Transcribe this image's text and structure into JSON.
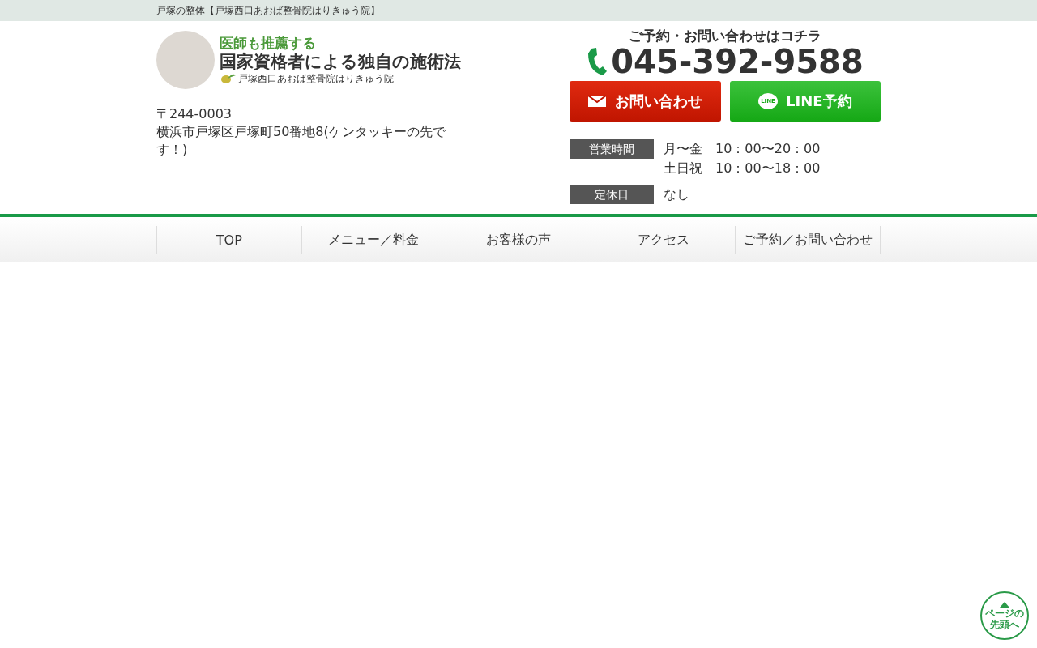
{
  "top_bar": {
    "text": "戸塚の整体【戸塚西口あおば整骨院はりきゅう院】"
  },
  "logo": {
    "tagline": "医師も推薦する",
    "headline": "国家資格者による独自の施術法",
    "clinic_name": "戸塚西口あおば整骨院はりきゅう院"
  },
  "address": {
    "postal": "〒244-0003",
    "street": "横浜市戸塚区戸塚町50番地8(ケンタッキーの先です！)"
  },
  "contact": {
    "caption": "ご予約・お問い合わせはコチラ",
    "phone": "045-392-9588",
    "buttons": [
      {
        "kind": "mail",
        "label": "お問い合わせ"
      },
      {
        "kind": "line",
        "label": "LINE予約",
        "icon_text": "LINE"
      }
    ]
  },
  "hours": [
    {
      "label": "営業時間",
      "lines": [
        "月〜金　10：00〜20：00",
        "土日祝　10：00〜18：00"
      ]
    },
    {
      "label": "定休日",
      "lines": [
        "なし"
      ]
    }
  ],
  "nav": [
    "TOP",
    "メニュー／料金",
    "お客様の声",
    "アクセス",
    "ご予約／お問い合わせ"
  ],
  "page_top_button": {
    "label": "ページの先頭へ"
  }
}
